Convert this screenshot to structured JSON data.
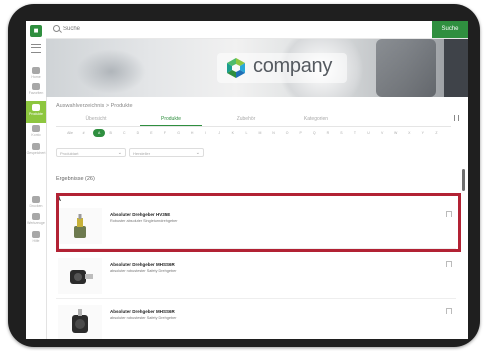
{
  "topbar": {
    "search_placeholder": "Suche",
    "search_button": "Suche"
  },
  "rail": {
    "logo": "■",
    "items": [
      {
        "label": "Home",
        "icon": "home-icon"
      },
      {
        "label": "Favoriten",
        "icon": "heart-icon"
      },
      {
        "label": "Produkte",
        "icon": "lightbulb-icon",
        "active": true
      },
      {
        "label": "Konto",
        "icon": "user-icon"
      },
      {
        "label": "Gespeichert",
        "icon": "bookmark-icon"
      },
      {
        "label": "Drucken",
        "icon": "print-icon"
      },
      {
        "label": "Werkzeuge",
        "icon": "tool-icon"
      },
      {
        "label": "Hilfe",
        "icon": "help-icon"
      }
    ]
  },
  "banner": {
    "brand_name": "company"
  },
  "breadcrumb": "Auswahlverzeichnis > Produkte",
  "tabs": [
    {
      "label": "Übersicht"
    },
    {
      "label": "Produkte",
      "active": true
    },
    {
      "label": "Zubehör"
    },
    {
      "label": "Kategorien"
    }
  ],
  "alphabet": [
    "Alle",
    "#",
    "A",
    "B",
    "C",
    "D",
    "E",
    "F",
    "G",
    "H",
    "I",
    "J",
    "K",
    "L",
    "M",
    "N",
    "O",
    "P",
    "Q",
    "R",
    "S",
    "T",
    "U",
    "V",
    "W",
    "X",
    "Y",
    "Z"
  ],
  "alphabet_selected": "A",
  "filters": [
    {
      "label": "Produktart"
    },
    {
      "label": "Hersteller"
    }
  ],
  "results_label": "Ergebnisse (26)",
  "group_letter": "A",
  "products": [
    {
      "title": "Absoluter Drehgeber HV35E",
      "description": "Robuster absoluter Singleturndrehgeber"
    },
    {
      "title": "Absoluter Drehgeber MHSS6R",
      "description": "absoluter robustester Safety Drehgeber"
    },
    {
      "title": "Absoluter Drehgeber MHSS6R",
      "description": "absoluter robustester Safety Drehgeber"
    }
  ],
  "colors": {
    "accent": "#2f8f3f",
    "active_rail": "#8dc63f",
    "highlight": "#b22234"
  }
}
